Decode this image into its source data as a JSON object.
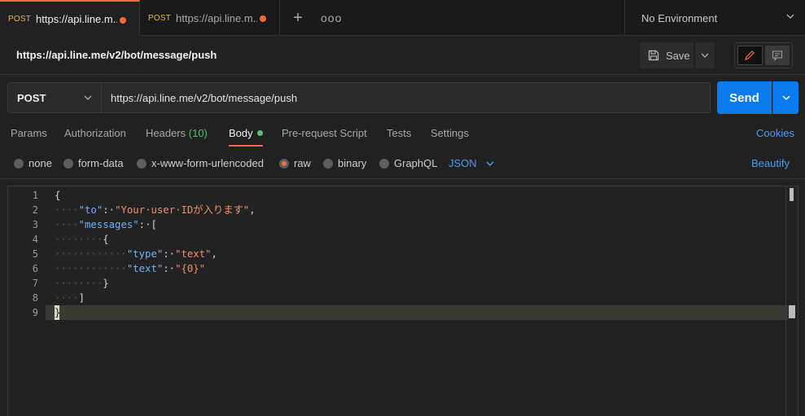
{
  "tabs": [
    {
      "method": "POST",
      "url": "https://api.line.m...",
      "active": true
    },
    {
      "method": "POST",
      "url": "https://api.line.m...",
      "active": false
    }
  ],
  "tab_actions": {
    "new_tab": "+",
    "more": "ooo"
  },
  "environment": {
    "label": "No Environment"
  },
  "request": {
    "title": "https://api.line.me/v2/bot/message/push",
    "save_label": "Save",
    "method": "POST",
    "url": "https://api.line.me/v2/bot/message/push",
    "send_label": "Send"
  },
  "request_tabs": {
    "params": "Params",
    "authorization": "Authorization",
    "headers": "Headers",
    "headers_count": "(10)",
    "body": "Body",
    "prerequest": "Pre-request Script",
    "tests": "Tests",
    "settings": "Settings",
    "cookies": "Cookies"
  },
  "body_types": {
    "none": "none",
    "form_data": "form-data",
    "urlencoded": "x-www-form-urlencoded",
    "raw": "raw",
    "binary": "binary",
    "graphql": "GraphQL",
    "language": "JSON",
    "beautify": "Beautify"
  },
  "editor": {
    "line_numbers": [
      "1",
      "2",
      "3",
      "4",
      "5",
      "6",
      "7",
      "8",
      "9"
    ],
    "l1": "{",
    "l2_ws": "····",
    "l2_key": "\"to\"",
    "l2_colon": ":·",
    "l2_val": "\"Your·user·IDが入ります\"",
    "l2_end": ",",
    "l3_ws": "····",
    "l3_key": "\"messages\"",
    "l3_rest": ":·[",
    "l4_ws": "········",
    "l4": "{",
    "l5_ws": "············",
    "l5_key": "\"type\"",
    "l5_colon": ":·",
    "l5_val": "\"text\"",
    "l5_end": ",",
    "l6_ws": "············",
    "l6_key": "\"text\"",
    "l6_colon": ":·",
    "l6_val": "\"{0}\"",
    "l7_ws": "········",
    "l7": "}",
    "l8_ws": "····",
    "l8": "]",
    "l9": "}"
  },
  "colors": {
    "accent_orange": "#f26b3a",
    "send_blue": "#097bed",
    "link_blue": "#4c9ded",
    "green": "#52c27a"
  }
}
